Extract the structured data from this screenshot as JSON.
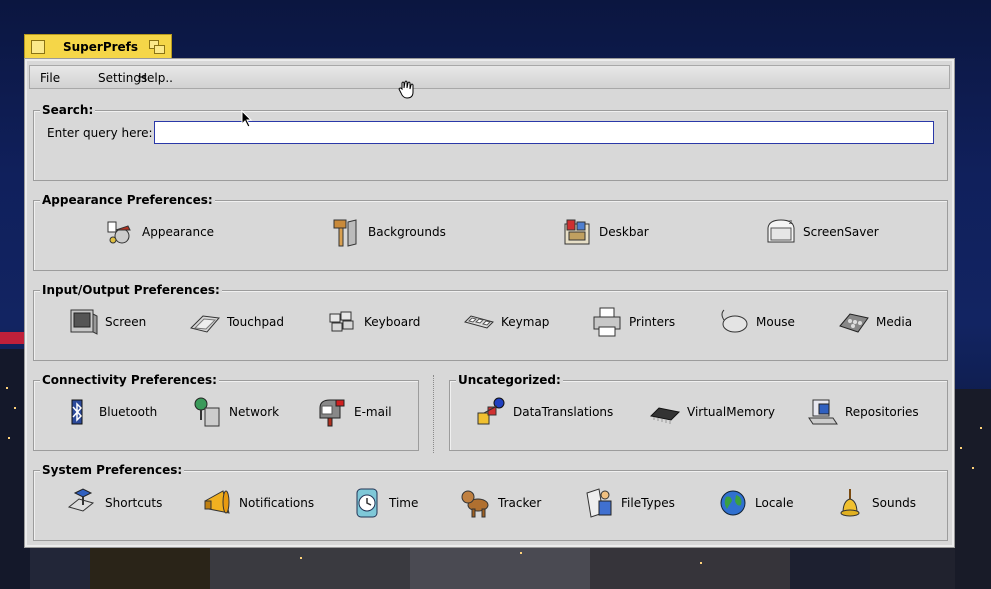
{
  "window": {
    "title": "SuperPrefs"
  },
  "menu": {
    "file": "File",
    "settings": "Settings",
    "help": "Help.."
  },
  "search": {
    "heading": "Search:",
    "label": "Enter query here:",
    "value": ""
  },
  "sections": {
    "appearance": {
      "heading": "Appearance Preferences:",
      "items": [
        "Appearance",
        "Backgrounds",
        "Deskbar",
        "ScreenSaver"
      ]
    },
    "io": {
      "heading": "Input/Output Preferences:",
      "items": [
        "Screen",
        "Touchpad",
        "Keyboard",
        "Keymap",
        "Printers",
        "Mouse",
        "Media"
      ]
    },
    "connectivity": {
      "heading": "Connectivity Preferences:",
      "items": [
        "Bluetooth",
        "Network",
        "E-mail"
      ]
    },
    "uncategorized": {
      "heading": "Uncategorized:",
      "items": [
        "DataTranslations",
        "VirtualMemory",
        "Repositories"
      ]
    },
    "system": {
      "heading": "System Preferences:",
      "items": [
        "Shortcuts",
        "Notifications",
        "Time",
        "Tracker",
        "FileTypes",
        "Locale",
        "Sounds"
      ]
    }
  },
  "colors": {
    "tab": "#f5d648",
    "panel": "#d8d8d8",
    "search_border": "#2a38a8"
  },
  "icons": {
    "appearance": "appearance-icon",
    "backgrounds": "backgrounds-icon",
    "deskbar": "deskbar-icon",
    "screensaver": "screensaver-icon",
    "screen": "screen-icon",
    "touchpad": "touchpad-icon",
    "keyboard": "keyboard-icon",
    "keymap": "keymap-icon",
    "printers": "printer-icon",
    "mouse": "mouse-icon",
    "media": "media-icon",
    "bluetooth": "bluetooth-icon",
    "network": "network-icon",
    "email": "mailbox-icon",
    "datatranslations": "datatranslations-icon",
    "virtualmemory": "memory-chip-icon",
    "repositories": "repositories-icon",
    "shortcuts": "shortcuts-icon",
    "notifications": "megaphone-icon",
    "time": "clock-icon",
    "tracker": "tracker-dog-icon",
    "filetypes": "filetypes-icon",
    "locale": "globe-icon",
    "sounds": "bell-icon"
  }
}
